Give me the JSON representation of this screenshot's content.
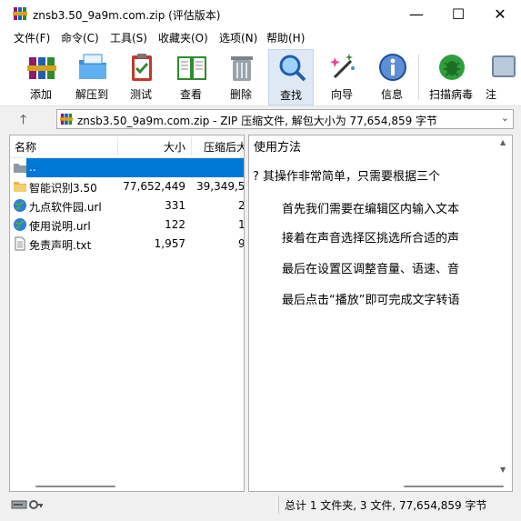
{
  "window": {
    "title": "znsb3.50_9a9m.com.zip (评估版本)",
    "minimize_glyph": "—",
    "maximize_glyph": "☐",
    "close_glyph": "✕",
    "app_icon": "winrar-books-icon"
  },
  "menu": {
    "items": [
      "文件(F)",
      "命令(C)",
      "工具(S)",
      "收藏夹(O)",
      "选项(N)",
      "帮助(H)"
    ]
  },
  "toolbar": {
    "buttons": [
      {
        "label": "添加",
        "icon": "add-archive-icon"
      },
      {
        "label": "解压到",
        "icon": "extract-folder-icon"
      },
      {
        "label": "测试",
        "icon": "test-clipboard-icon"
      },
      {
        "label": "查看",
        "icon": "view-book-icon"
      },
      {
        "label": "删除",
        "icon": "trash-can-icon"
      },
      {
        "label": "查找",
        "icon": "magnifier-icon"
      },
      {
        "label": "向导",
        "icon": "wizard-wand-icon"
      },
      {
        "label": "信息",
        "icon": "info-icon"
      },
      {
        "label": "扫描病毒",
        "icon": "virus-scan-icon"
      },
      {
        "label": "注",
        "icon": "comment-icon"
      }
    ]
  },
  "address": {
    "up_glyph": "🡑",
    "text": "znsb3.50_9a9m.com.zip - ZIP 压缩文件, 解包大小为 77,654,859 字节",
    "dropdown_glyph": "⌄"
  },
  "file_list": {
    "columns": {
      "name": "名称",
      "size": "大小",
      "packed": "压缩后大"
    },
    "rows": [
      {
        "name": "..",
        "size": "",
        "packed": "",
        "icon": "parent-folder-icon",
        "selected": true
      },
      {
        "name": "智能识别3.50",
        "size": "77,652,449",
        "packed": "39,349,5",
        "icon": "folder-icon",
        "selected": false
      },
      {
        "name": "九点软件园.url",
        "size": "331",
        "packed": "2",
        "icon": "globe-url-icon",
        "selected": false
      },
      {
        "name": "使用说明.url",
        "size": "122",
        "packed": "1",
        "icon": "globe-url-icon",
        "selected": false
      },
      {
        "name": "免责声明.txt",
        "size": "1,957",
        "packed": "9",
        "icon": "text-file-icon",
        "selected": false
      }
    ]
  },
  "comment": {
    "title": "使用方法",
    "lines": [
      "?     其操作非常简单，只需要根据三个",
      "首先我们需要在编辑区内输入文本",
      "接着在声音选择区挑选所合适的声",
      "最后在设置区调整音量、语速、音",
      "最后点击“播放”即可完成文字转语"
    ]
  },
  "status": {
    "text": "总计 1 文件夹, 3 文件, 77,654,859 字节",
    "icons": "drive-key-icon"
  },
  "colors": {
    "selection": "#0078d7",
    "window_bg": "#f0f0f0"
  }
}
